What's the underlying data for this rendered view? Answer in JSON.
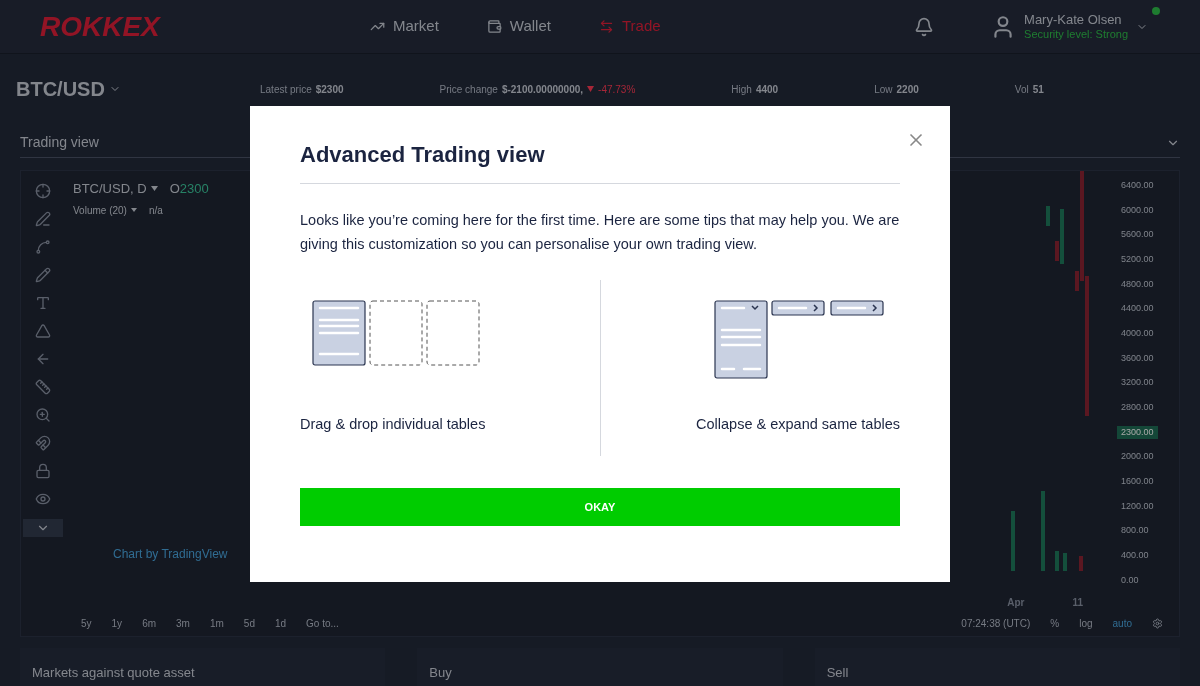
{
  "header": {
    "logo": "ROKKEX",
    "nav": [
      {
        "kind": "market",
        "label": "Market",
        "selected": false
      },
      {
        "kind": "wallet",
        "label": "Wallet",
        "selected": false
      },
      {
        "kind": "trade",
        "label": "Trade",
        "selected": true
      }
    ],
    "user": {
      "name": "Mary-Kate Olsen",
      "security": "Security level: Strong",
      "online": true
    }
  },
  "ticker": {
    "pair": "BTC/USD",
    "stats": [
      {
        "label": "Latest price",
        "value": "$2300"
      },
      {
        "label": "Price change",
        "value": "$-2100.00000000,",
        "change": "-47.73%"
      },
      {
        "label": "High",
        "value": "4400"
      },
      {
        "label": "Low",
        "value": "2200"
      },
      {
        "label": "Vol",
        "value": "51"
      }
    ]
  },
  "trading_view": {
    "title": "Trading view",
    "expanded": true,
    "symbol": "BTC/USD, D",
    "open_label": "O",
    "open_value": "2300",
    "volume": "Volume (20)",
    "volume_value": "n/a",
    "watermark": "Chart by TradingView",
    "price_axis": [
      "6400.00",
      "6000.00",
      "5600.00",
      "5200.00",
      "4800.00",
      "4400.00",
      "4000.00",
      "3600.00",
      "3200.00",
      "2800.00",
      "2000.00",
      "1600.00",
      "1200.00",
      "800.00",
      "400.00",
      "0.00"
    ],
    "current_price": "2300.00",
    "time_axis": [
      "Apr",
      "11"
    ],
    "ranges": [
      "5y",
      "1y",
      "6m",
      "3m",
      "1m",
      "5d",
      "1d",
      "Go to..."
    ],
    "clock": "07:24:38 (UTC)",
    "scale_options": [
      {
        "label": "%",
        "selected": false
      },
      {
        "label": "log",
        "selected": false
      },
      {
        "label": "auto",
        "selected": true
      }
    ]
  },
  "panels": [
    "Markets against quote asset",
    "Buy",
    "Sell"
  ],
  "modal": {
    "title": "Advanced Trading view",
    "text": "Looks like you’re coming here for the first time. Here are some tips that may help you. We are giving this customization so you can personalise your own trading view.",
    "tips": [
      {
        "kind": "drag",
        "caption": "Drag & drop individual tables"
      },
      {
        "kind": "collapse",
        "caption": "Collapse & expand same tables"
      }
    ],
    "button": "OKAY"
  }
}
